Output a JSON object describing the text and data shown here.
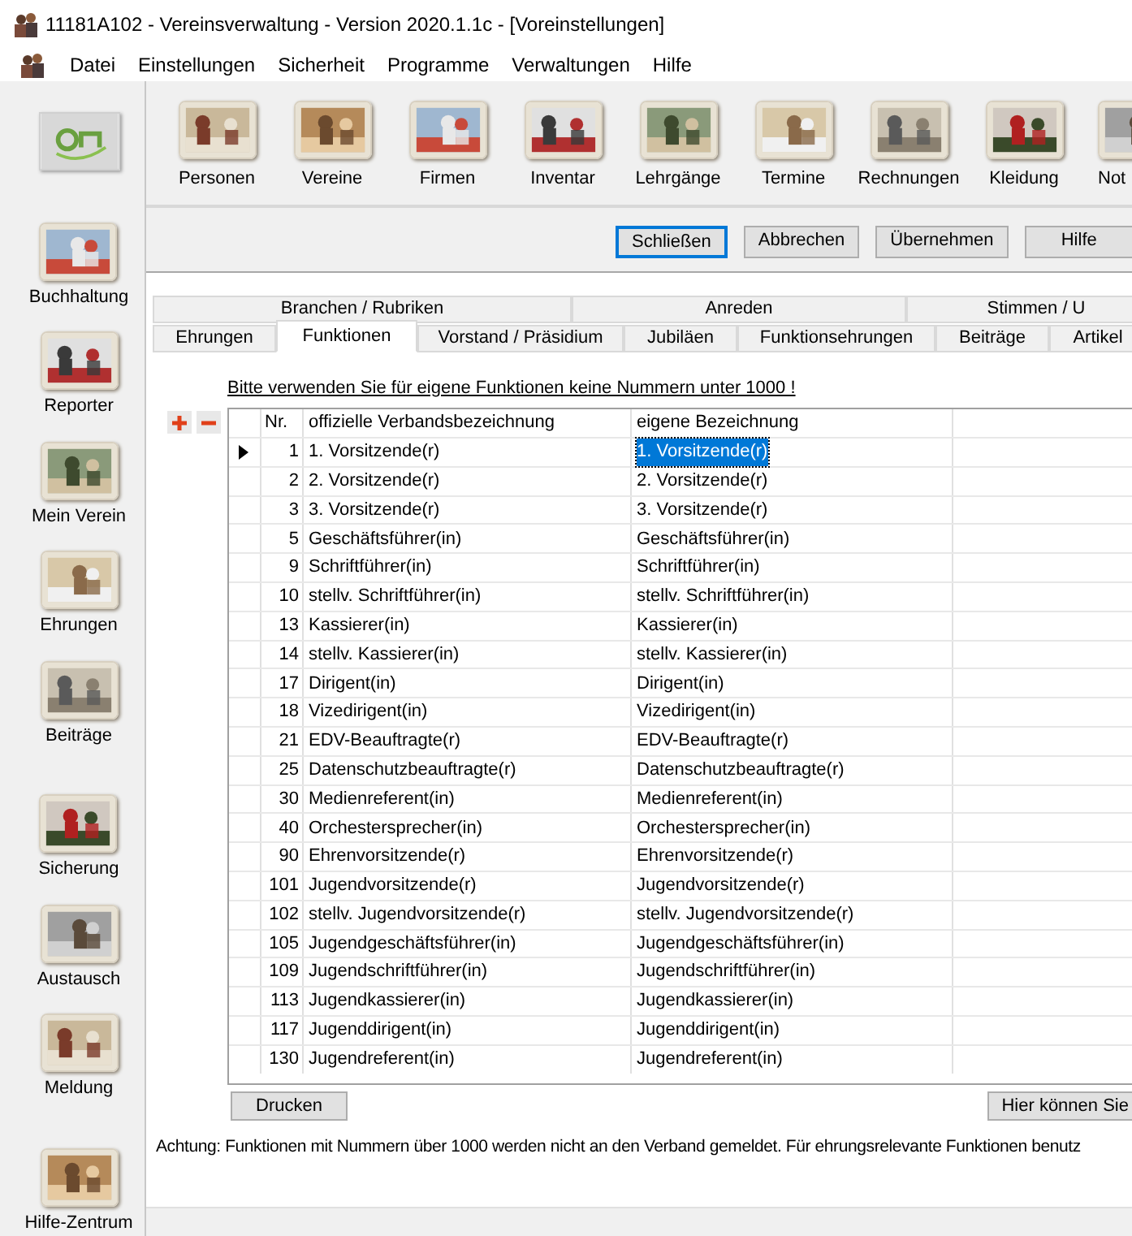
{
  "window": {
    "title": "11181A102 - Vereinsverwaltung - Version 2020.1.1c - [Voreinstellungen]"
  },
  "menu": [
    "Datei",
    "Einstellungen",
    "Sicherheit",
    "Programme",
    "Verwaltungen",
    "Hilfe"
  ],
  "toolbar": [
    {
      "label": "Personen"
    },
    {
      "label": "Vereine"
    },
    {
      "label": "Firmen"
    },
    {
      "label": "Inventar"
    },
    {
      "label": "Lehrgänge"
    },
    {
      "label": "Termine"
    },
    {
      "label": "Rechnungen"
    },
    {
      "label": "Kleidung"
    },
    {
      "label": "Not"
    }
  ],
  "sidebar": [
    {
      "label": "Buchhaltung"
    },
    {
      "label": "Reporter"
    },
    {
      "label": "Mein Verein"
    },
    {
      "label": "Ehrungen"
    },
    {
      "label": "Beiträge"
    },
    {
      "label": "Sicherung"
    },
    {
      "label": "Austausch"
    },
    {
      "label": "Meldung"
    },
    {
      "label": "Hilfe-Zentrum"
    }
  ],
  "actions": [
    {
      "label": "Schließen",
      "selected": true
    },
    {
      "label": "Abbrechen",
      "selected": false
    },
    {
      "label": "Übernehmen",
      "selected": false
    },
    {
      "label": "Hilfe",
      "selected": false
    }
  ],
  "tabs_top": [
    "Branchen / Rubriken",
    "Anreden",
    "Stimmen / U"
  ],
  "tabs": [
    {
      "label": "Ehrungen",
      "selected": false
    },
    {
      "label": "Funktionen",
      "selected": true
    },
    {
      "label": "Vorstand / Präsidium",
      "selected": false
    },
    {
      "label": "Jubiläen",
      "selected": false
    },
    {
      "label": "Funktionsehrungen",
      "selected": false
    },
    {
      "label": "Beiträge",
      "selected": false
    },
    {
      "label": "Artikel",
      "selected": false
    }
  ],
  "hint": "Bitte verwenden Sie für eigene Funktionen keine Nummern unter 1000 !",
  "table": {
    "columns": [
      "Nr.",
      "offizielle Verbandsbezeichnung",
      "eigene Bezeichnung"
    ],
    "rows": [
      {
        "nr": "1",
        "official": "1. Vorsitzende(r)",
        "own": "1. Vorsitzende(r)",
        "selected": true
      },
      {
        "nr": "2",
        "official": "2. Vorsitzende(r)",
        "own": "2. Vorsitzende(r)",
        "selected": false
      },
      {
        "nr": "3",
        "official": "3. Vorsitzende(r)",
        "own": "3. Vorsitzende(r)",
        "selected": false
      },
      {
        "nr": "5",
        "official": "Geschäftsführer(in)",
        "own": "Geschäftsführer(in)",
        "selected": false
      },
      {
        "nr": "9",
        "official": "Schriftführer(in)",
        "own": "Schriftführer(in)",
        "selected": false
      },
      {
        "nr": "10",
        "official": "stellv. Schriftführer(in)",
        "own": "stellv. Schriftführer(in)",
        "selected": false
      },
      {
        "nr": "13",
        "official": "Kassierer(in)",
        "own": "Kassierer(in)",
        "selected": false
      },
      {
        "nr": "14",
        "official": "stellv. Kassierer(in)",
        "own": "stellv. Kassierer(in)",
        "selected": false
      },
      {
        "nr": "17",
        "official": "Dirigent(in)",
        "own": "Dirigent(in)",
        "selected": false
      },
      {
        "nr": "18",
        "official": "Vizedirigent(in)",
        "own": "Vizedirigent(in)",
        "selected": false
      },
      {
        "nr": "21",
        "official": "EDV-Beauftragte(r)",
        "own": "EDV-Beauftragte(r)",
        "selected": false
      },
      {
        "nr": "25",
        "official": "Datenschutzbeauftragte(r)",
        "own": "Datenschutzbeauftragte(r)",
        "selected": false
      },
      {
        "nr": "30",
        "official": "Medienreferent(in)",
        "own": "Medienreferent(in)",
        "selected": false
      },
      {
        "nr": "40",
        "official": "Orchestersprecher(in)",
        "own": "Orchestersprecher(in)",
        "selected": false
      },
      {
        "nr": "90",
        "official": "Ehrenvorsitzende(r)",
        "own": "Ehrenvorsitzende(r)",
        "selected": false
      },
      {
        "nr": "101",
        "official": "Jugendvorsitzende(r)",
        "own": "Jugendvorsitzende(r)",
        "selected": false
      },
      {
        "nr": "102",
        "official": "stellv. Jugendvorsitzende(r)",
        "own": "stellv. Jugendvorsitzende(r)",
        "selected": false
      },
      {
        "nr": "105",
        "official": "Jugendgeschäftsführer(in)",
        "own": "Jugendgeschäftsführer(in)",
        "selected": false
      },
      {
        "nr": "109",
        "official": "Jugendschriftführer(in)",
        "own": "Jugendschriftführer(in)",
        "selected": false
      },
      {
        "nr": "113",
        "official": "Jugendkassierer(in)",
        "own": "Jugendkassierer(in)",
        "selected": false
      },
      {
        "nr": "117",
        "official": "Jugenddirigent(in)",
        "own": "Jugenddirigent(in)",
        "selected": false
      },
      {
        "nr": "130",
        "official": "Jugendreferent(in)",
        "own": "Jugendreferent(in)",
        "selected": false
      }
    ]
  },
  "print_button": "Drucken",
  "right_button": "Hier können Sie",
  "notice": "Achtung: Funktionen mit Nummern über 1000 werden nicht an den Verband gemeldet. Für ehrungsrelevante Funktionen benutz"
}
